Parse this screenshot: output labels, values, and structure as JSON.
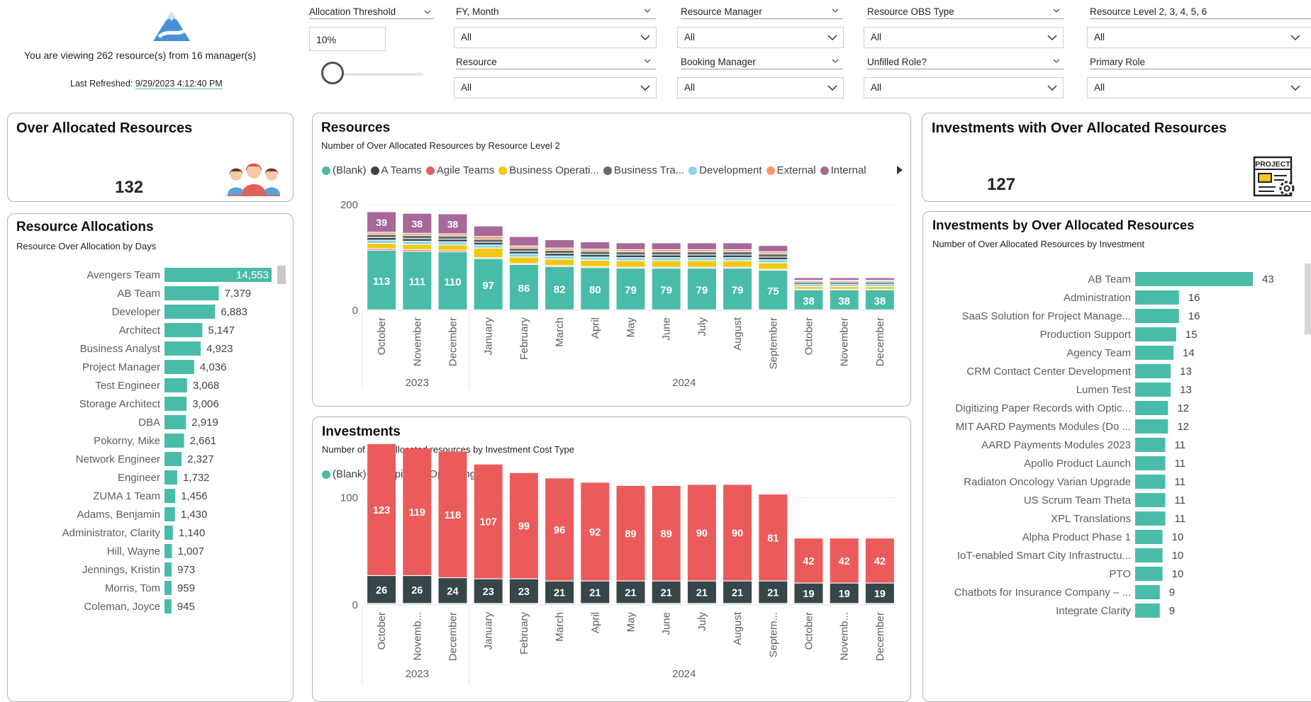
{
  "header": {
    "viewing_text": "You are viewing 262 resource(s) from 16 manager(s)",
    "refreshed_label": "Last Refreshed:",
    "refreshed_value": "9/29/2023 4:12:40 PM"
  },
  "filters": {
    "threshold": {
      "label": "Allocation Threshold",
      "value": "10%",
      "slider_fraction": 0.0
    },
    "fy_month": {
      "label": "FY, Month",
      "value": "All"
    },
    "resource": {
      "label": "Resource",
      "value": "All"
    },
    "resource_manager": {
      "label": "Resource Manager",
      "value": "All"
    },
    "booking_manager": {
      "label": "Booking Manager",
      "value": "All"
    },
    "obs_type": {
      "label": "Resource OBS Type",
      "value": "All"
    },
    "unfilled_role": {
      "label": "Unfilled Role?",
      "value": "All"
    },
    "resource_level": {
      "label": "Resource Level 2, 3, 4, 5, 6",
      "value": "All"
    },
    "primary_role": {
      "label": "Primary Role",
      "value": "All"
    }
  },
  "kpi_resources": {
    "title": "Over Allocated Resources",
    "value": "132"
  },
  "kpi_investments": {
    "title": "Investments with Over Allocated Resources",
    "value": "127",
    "icon_label": "PROJECT"
  },
  "resource_alloc": {
    "title": "Resource Allocations",
    "subtitle": "Resource Over Allocation by Days",
    "bar_color": "#49bca9",
    "max": 14553,
    "rows": [
      {
        "label": "Avengers Team",
        "value": 14553,
        "text": "14,553"
      },
      {
        "label": "AB Team",
        "value": 7379,
        "text": "7,379"
      },
      {
        "label": "Developer",
        "value": 6883,
        "text": "6,883"
      },
      {
        "label": "Architect",
        "value": 5147,
        "text": "5,147"
      },
      {
        "label": "Business Analyst",
        "value": 4923,
        "text": "4,923"
      },
      {
        "label": "Project Manager",
        "value": 4036,
        "text": "4,036"
      },
      {
        "label": "Test Engineer",
        "value": 3068,
        "text": "3,068"
      },
      {
        "label": "Storage Architect",
        "value": 3006,
        "text": "3,006"
      },
      {
        "label": "DBA",
        "value": 2919,
        "text": "2,919"
      },
      {
        "label": "Pokorny, Mike",
        "value": 2661,
        "text": "2,661"
      },
      {
        "label": "Network Engineer",
        "value": 2327,
        "text": "2,327"
      },
      {
        "label": "Engineer",
        "value": 1732,
        "text": "1,732"
      },
      {
        "label": "ZUMA 1 Team",
        "value": 1456,
        "text": "1,456"
      },
      {
        "label": "Adams, Benjamin",
        "value": 1430,
        "text": "1,430"
      },
      {
        "label": "Administrator, Clarity",
        "value": 1140,
        "text": "1,140"
      },
      {
        "label": "Hill, Wayne",
        "value": 1007,
        "text": "1,007"
      },
      {
        "label": "Jennings, Kristin",
        "value": 973,
        "text": "973"
      },
      {
        "label": "Morris, Tom",
        "value": 959,
        "text": "959"
      },
      {
        "label": "Coleman, Joyce",
        "value": 945,
        "text": "945"
      }
    ]
  },
  "resources_chart": {
    "title": "Resources",
    "subtitle": "Number of Over Allocated Resources by Resource Level 2",
    "legend": [
      {
        "name": "(Blank)",
        "color": "#49bca9"
      },
      {
        "name": "A Teams",
        "color": "#374649"
      },
      {
        "name": "Agile Teams",
        "color": "#ec5b5b"
      },
      {
        "name": "Business Operati...",
        "color": "#f2c811"
      },
      {
        "name": "Business Tra...",
        "color": "#5f6b6d"
      },
      {
        "name": "Development",
        "color": "#8ad4eb"
      },
      {
        "name": "External",
        "color": "#fe9666"
      },
      {
        "name": "Internal",
        "color": "#a66999"
      }
    ],
    "y_ticks": [
      "200",
      "0"
    ],
    "months": [
      "October",
      "November",
      "December",
      "January",
      "February",
      "March",
      "April",
      "May",
      "June",
      "July",
      "August",
      "September",
      "October",
      "November",
      "December"
    ],
    "years": [
      {
        "label": "2023",
        "span": 3
      },
      {
        "label": "2024",
        "span": 12
      }
    ],
    "blank_labels": [
      "113",
      "111",
      "110",
      "97",
      "86",
      "82",
      "80",
      "79",
      "79",
      "79",
      "79",
      "75",
      "38",
      "38",
      "38"
    ],
    "internal_labels": [
      "39",
      "38",
      "38"
    ]
  },
  "investments_chart": {
    "title": "Investments",
    "subtitle": "Number of Over Allocated resources by Investment Cost Type",
    "legend": [
      {
        "name": "(Blank)",
        "color": "#49bca9"
      },
      {
        "name": "Capital",
        "color": "#374649"
      },
      {
        "name": "Operating",
        "color": "#ec5b5b"
      }
    ],
    "y_ticks": [
      "100",
      "0"
    ],
    "months": [
      "October",
      "Novemb...",
      "December",
      "January",
      "February",
      "March",
      "April",
      "May",
      "June",
      "July",
      "August",
      "Septem...",
      "October",
      "Novemb...",
      "December"
    ],
    "years": [
      {
        "label": "2023",
        "span": 3
      },
      {
        "label": "2024",
        "span": 12
      }
    ]
  },
  "investments_list": {
    "title": "Investments by Over Allocated Resources",
    "subtitle": "Number of Over Allocated Resources by Investment",
    "bar_color": "#49bca9",
    "max": 43,
    "rows": [
      {
        "label": "AB Team",
        "value": 43
      },
      {
        "label": "Administration",
        "value": 16
      },
      {
        "label": "SaaS Solution for Project Manage...",
        "value": 16
      },
      {
        "label": "Production Support",
        "value": 15
      },
      {
        "label": "Agency Team",
        "value": 14
      },
      {
        "label": "CRM Contact Center Development",
        "value": 13
      },
      {
        "label": "Lumen Test",
        "value": 13
      },
      {
        "label": "Digitizing Paper Records with Optic...",
        "value": 12
      },
      {
        "label": "MIT AARD Payments Modules (Do ...",
        "value": 12
      },
      {
        "label": "AARD Payments Modules 2023",
        "value": 11
      },
      {
        "label": "Apollo Product Launch",
        "value": 11
      },
      {
        "label": "Radiaton Oncology Varian Upgrade",
        "value": 11
      },
      {
        "label": "US Scrum Team Theta",
        "value": 11
      },
      {
        "label": "XPL Translations",
        "value": 11
      },
      {
        "label": "Alpha Product Phase 1",
        "value": 10
      },
      {
        "label": "IoT-enabled Smart City Infrastructu...",
        "value": 10
      },
      {
        "label": "PTO",
        "value": 10
      },
      {
        "label": "Chatbots for Insurance Company – ...",
        "value": 9
      },
      {
        "label": "Integrate Clarity",
        "value": 9
      }
    ]
  },
  "chart_data": [
    {
      "type": "bar",
      "title": "Resources",
      "subtitle": "Number of Over Allocated Resources by Resource Level 2",
      "stacked": true,
      "categories": [
        "Oct 2023",
        "Nov 2023",
        "Dec 2023",
        "Jan 2024",
        "Feb 2024",
        "Mar 2024",
        "Apr 2024",
        "May 2024",
        "Jun 2024",
        "Jul 2024",
        "Aug 2024",
        "Sep 2024",
        "Oct 2024",
        "Nov 2024",
        "Dec 2024"
      ],
      "series": [
        {
          "name": "(Blank)",
          "values": [
            113,
            111,
            110,
            97,
            86,
            82,
            80,
            79,
            79,
            79,
            79,
            75,
            38,
            38,
            38
          ]
        },
        {
          "name": "Agile Teams",
          "values": [
            3,
            3,
            3,
            2,
            2,
            2,
            2,
            2,
            2,
            2,
            2,
            2,
            1,
            1,
            1
          ]
        },
        {
          "name": "Business Operati...",
          "values": [
            10,
            10,
            10,
            18,
            12,
            12,
            12,
            12,
            12,
            12,
            12,
            12,
            5,
            5,
            5
          ]
        },
        {
          "name": "Development",
          "values": [
            6,
            6,
            6,
            6,
            6,
            6,
            6,
            6,
            6,
            6,
            6,
            6,
            4,
            4,
            4
          ]
        },
        {
          "name": "A Teams",
          "values": [
            5,
            5,
            5,
            5,
            5,
            5,
            5,
            5,
            5,
            5,
            5,
            5,
            3,
            3,
            3
          ]
        },
        {
          "name": "Business Tra...",
          "values": [
            6,
            6,
            6,
            6,
            6,
            6,
            6,
            6,
            6,
            6,
            6,
            6,
            3,
            3,
            3
          ]
        },
        {
          "name": "External",
          "values": [
            4,
            4,
            4,
            5,
            4,
            4,
            4,
            4,
            4,
            4,
            4,
            4,
            2,
            2,
            2
          ]
        },
        {
          "name": "Internal",
          "values": [
            39,
            38,
            38,
            20,
            18,
            16,
            14,
            13,
            13,
            13,
            13,
            12,
            5,
            5,
            5
          ]
        }
      ],
      "y_ticks": [
        0,
        200
      ],
      "ylim": [
        0,
        290
      ],
      "legend_position": "top"
    },
    {
      "type": "bar",
      "title": "Investments",
      "subtitle": "Number of Over Allocated resources by Investment Cost Type",
      "stacked": true,
      "categories": [
        "Oct 2023",
        "Nov 2023",
        "Dec 2023",
        "Jan 2024",
        "Feb 2024",
        "Mar 2024",
        "Apr 2024",
        "May 2024",
        "Jun 2024",
        "Jul 2024",
        "Aug 2024",
        "Sep 2024",
        "Oct 2024",
        "Nov 2024",
        "Dec 2024"
      ],
      "series": [
        {
          "name": "(Blank)",
          "values": [
            1,
            1,
            1,
            1,
            1,
            1,
            1,
            1,
            1,
            1,
            1,
            1,
            1,
            1,
            1
          ]
        },
        {
          "name": "Capital",
          "values": [
            26,
            26,
            24,
            23,
            23,
            21,
            21,
            21,
            21,
            21,
            21,
            21,
            19,
            19,
            19
          ]
        },
        {
          "name": "Operating",
          "values": [
            123,
            119,
            118,
            107,
            99,
            96,
            92,
            89,
            89,
            90,
            90,
            81,
            42,
            42,
            42
          ]
        }
      ],
      "y_ticks": [
        0,
        100
      ],
      "ylim": [
        0,
        175
      ],
      "legend_position": "top"
    },
    {
      "type": "bar",
      "orientation": "horizontal",
      "title": "Resource Allocations",
      "subtitle": "Resource Over Allocation by Days",
      "categories": [
        "Avengers Team",
        "AB Team",
        "Developer",
        "Architect",
        "Business Analyst",
        "Project Manager",
        "Test Engineer",
        "Storage Architect",
        "DBA",
        "Pokorny, Mike",
        "Network Engineer",
        "Engineer",
        "ZUMA 1 Team",
        "Adams, Benjamin",
        "Administrator, Clarity",
        "Hill, Wayne",
        "Jennings, Kristin",
        "Morris, Tom",
        "Coleman, Joyce"
      ],
      "values": [
        14553,
        7379,
        6883,
        5147,
        4923,
        4036,
        3068,
        3006,
        2919,
        2661,
        2327,
        1732,
        1456,
        1430,
        1140,
        1007,
        973,
        959,
        945
      ]
    },
    {
      "type": "bar",
      "orientation": "horizontal",
      "title": "Investments by Over Allocated Resources",
      "subtitle": "Number of Over Allocated Resources by Investment",
      "categories": [
        "AB Team",
        "Administration",
        "SaaS Solution for Project Manage...",
        "Production Support",
        "Agency Team",
        "CRM Contact Center Development",
        "Lumen Test",
        "Digitizing Paper Records with Optic...",
        "MIT AARD Payments Modules (Do ...",
        "AARD Payments Modules 2023",
        "Apollo Product Launch",
        "Radiaton Oncology Varian Upgrade",
        "US Scrum Team Theta",
        "XPL Translations",
        "Alpha Product Phase 1",
        "IoT-enabled Smart City Infrastructu...",
        "PTO",
        "Chatbots for Insurance Company – ...",
        "Integrate Clarity"
      ],
      "values": [
        43,
        16,
        16,
        15,
        14,
        13,
        13,
        12,
        12,
        11,
        11,
        11,
        11,
        11,
        10,
        10,
        10,
        9,
        9
      ]
    }
  ]
}
